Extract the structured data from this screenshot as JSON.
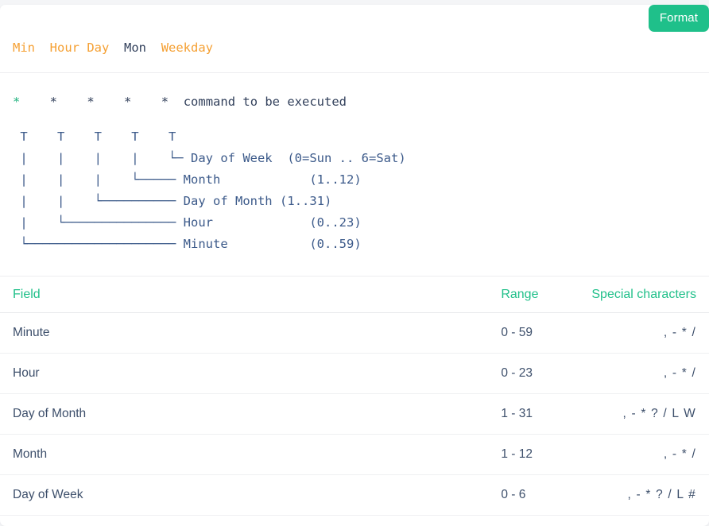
{
  "toolbar": {
    "format_label": "Format"
  },
  "field_nav": {
    "items": [
      {
        "label": "Min",
        "active": false
      },
      {
        "label": "Hour",
        "active": false
      },
      {
        "label": "Day",
        "active": false
      },
      {
        "label": "Mon",
        "active": true
      },
      {
        "label": "Weekday",
        "active": false
      }
    ],
    "raw": "Min  Hour Day  Mon  Weekday"
  },
  "expression": {
    "fields": [
      "*",
      "*",
      "*",
      "*",
      "*"
    ],
    "command_text": "command to be executed",
    "raw": "*    *    *    *    *  command to be executed"
  },
  "tree": {
    "rows": [
      {
        "connector": " |    |    |    |    └─",
        "name_parts": [
          {
            "text": "Day",
            "kind": "field"
          },
          {
            "text": " of ",
            "kind": "plain"
          },
          {
            "text": "Week",
            "kind": "field"
          }
        ],
        "range_parts": [
          {
            "text": "(",
            "kind": "plain"
          },
          {
            "text": "0",
            "kind": "num"
          },
          {
            "text": "=Sun .. ",
            "kind": "plain"
          },
          {
            "text": "6",
            "kind": "num"
          },
          {
            "text": "=Sat)",
            "kind": "plain"
          }
        ]
      },
      {
        "connector": " |    |    |    └─────",
        "name_parts": [
          {
            "text": "Month",
            "kind": "field"
          }
        ],
        "range_parts": [
          {
            "text": "(",
            "kind": "plain"
          },
          {
            "text": "1",
            "kind": "num"
          },
          {
            "text": "..",
            "kind": "plain"
          },
          {
            "text": "12",
            "kind": "num"
          },
          {
            "text": ")",
            "kind": "plain"
          }
        ]
      },
      {
        "connector": " |    |    └──────────",
        "name_parts": [
          {
            "text": "Day",
            "kind": "field"
          },
          {
            "text": " of ",
            "kind": "plain"
          },
          {
            "text": "Month",
            "kind": "field"
          }
        ],
        "range_parts": [
          {
            "text": "(",
            "kind": "plain"
          },
          {
            "text": "1",
            "kind": "num"
          },
          {
            "text": "..",
            "kind": "plain"
          },
          {
            "text": "31",
            "kind": "num"
          },
          {
            "text": ")",
            "kind": "plain"
          }
        ]
      },
      {
        "connector": " |    └───────────────",
        "name_parts": [
          {
            "text": "Hour",
            "kind": "field"
          }
        ],
        "range_parts": [
          {
            "text": "(",
            "kind": "plain"
          },
          {
            "text": "0",
            "kind": "num"
          },
          {
            "text": "..",
            "kind": "plain"
          },
          {
            "text": "23",
            "kind": "num"
          },
          {
            "text": ")",
            "kind": "plain"
          }
        ]
      },
      {
        "connector": " └────────────────────",
        "name_parts": [
          {
            "text": "Minute",
            "kind": "field"
          }
        ],
        "range_parts": [
          {
            "text": "(",
            "kind": "plain"
          },
          {
            "text": "0",
            "kind": "num"
          },
          {
            "text": "..",
            "kind": "plain"
          },
          {
            "text": "59",
            "kind": "num"
          },
          {
            "text": ")",
            "kind": "plain"
          }
        ]
      }
    ],
    "top_row": " T    T    T    T    T"
  },
  "table": {
    "headers": {
      "field": "Field",
      "range": "Range",
      "special": "Special characters"
    },
    "rows": [
      {
        "field": "Minute",
        "range": "0 - 59",
        "special": ", - * /"
      },
      {
        "field": "Hour",
        "range": "0 - 23",
        "special": ", - * /"
      },
      {
        "field": "Day of Month",
        "range": "1 - 31",
        "special": ", - * ? / L W"
      },
      {
        "field": "Month",
        "range": "1 - 12",
        "special": ", - * /"
      },
      {
        "field": "Day of Week",
        "range": "0 - 6",
        "special": ", - * ? / L #"
      }
    ]
  },
  "colors": {
    "accent_green": "#21c08a",
    "field_orange": "#f5a033",
    "text_navy": "#33415c",
    "tree_blue": "#3c5a8a",
    "page_bg": "#f4f5f7"
  }
}
